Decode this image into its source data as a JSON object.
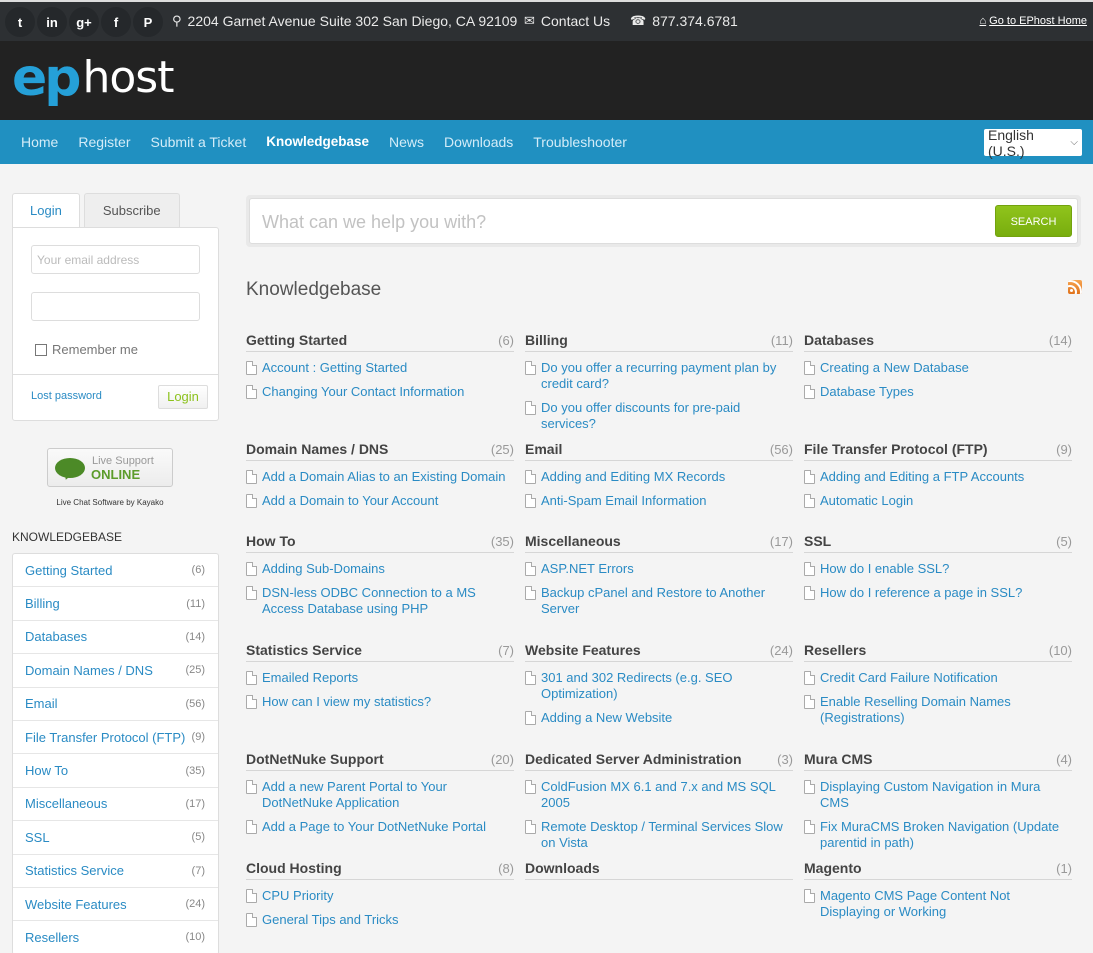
{
  "topbar": {
    "social": [
      {
        "name": "twitter-icon",
        "glyph": "t"
      },
      {
        "name": "linkedin-icon",
        "glyph": "in"
      },
      {
        "name": "google-plus-icon",
        "glyph": "g+"
      },
      {
        "name": "facebook-icon",
        "glyph": "f"
      },
      {
        "name": "pinterest-icon",
        "glyph": "P"
      }
    ],
    "address": "2204 Garnet Avenue Suite 302 San Diego, CA 92109",
    "contact": "Contact Us",
    "phone": "877.374.6781",
    "home_link": "Go to EPhost Home",
    "icons": {
      "pin": "⚲",
      "mail": "✉",
      "phone": "☎",
      "home": "⌂"
    }
  },
  "logo": {
    "ep": "ep",
    "host": "host"
  },
  "nav": {
    "items": [
      "Home",
      "Register",
      "Submit a Ticket",
      "Knowledgebase",
      "News",
      "Downloads",
      "Troubleshooter"
    ],
    "active": "Knowledgebase",
    "language": "English (U.S.)",
    "chevron": "⌵"
  },
  "login": {
    "tabs": [
      "Login",
      "Subscribe"
    ],
    "email_placeholder": "Your email address",
    "password_value": "",
    "remember": "Remember me",
    "lost_password": "Lost password",
    "login_button": "Login"
  },
  "live_support": {
    "line1": "Live Support",
    "line2": "ONLINE",
    "caption": "Live Chat Software by Kayako"
  },
  "sidebar": {
    "heading": "KNOWLEDGEBASE",
    "items": [
      {
        "label": "Getting Started",
        "count": "(6)"
      },
      {
        "label": "Billing",
        "count": "(11)"
      },
      {
        "label": "Databases",
        "count": "(14)"
      },
      {
        "label": "Domain Names / DNS",
        "count": "(25)"
      },
      {
        "label": "Email",
        "count": "(56)"
      },
      {
        "label": "File Transfer Protocol (FTP)",
        "count": "(9)"
      },
      {
        "label": "How To",
        "count": "(35)"
      },
      {
        "label": "Miscellaneous",
        "count": "(17)"
      },
      {
        "label": "SSL",
        "count": "(5)"
      },
      {
        "label": "Statistics Service",
        "count": "(7)"
      },
      {
        "label": "Website Features",
        "count": "(24)"
      },
      {
        "label": "Resellers",
        "count": "(10)"
      }
    ]
  },
  "search": {
    "placeholder": "What can we help you with?",
    "button": "SEARCH"
  },
  "main": {
    "title": "Knowledgebase",
    "categories": [
      {
        "name": "Getting Started",
        "count": "(6)",
        "articles": [
          "Account : Getting Started",
          "Changing Your Contact Information"
        ]
      },
      {
        "name": "Billing",
        "count": "(11)",
        "articles": [
          "Do you offer a recurring payment plan by credit card?",
          "Do you offer discounts for pre-paid services?"
        ]
      },
      {
        "name": "Databases",
        "count": "(14)",
        "articles": [
          "Creating a New Database",
          "Database Types"
        ]
      },
      {
        "name": "Domain Names / DNS",
        "count": "(25)",
        "articles": [
          "Add a Domain Alias to an Existing Domain",
          "Add a Domain to Your Account"
        ]
      },
      {
        "name": "Email",
        "count": "(56)",
        "articles": [
          "Adding and Editing MX Records",
          "Anti-Spam Email Information"
        ]
      },
      {
        "name": "File Transfer Protocol (FTP)",
        "count": "(9)",
        "articles": [
          "Adding and Editing a FTP Accounts",
          "Automatic Login"
        ]
      },
      {
        "name": "How To",
        "count": "(35)",
        "articles": [
          "Adding Sub-Domains",
          "DSN-less ODBC Connection to a MS Access Database using PHP"
        ]
      },
      {
        "name": "Miscellaneous",
        "count": "(17)",
        "articles": [
          "ASP.NET Errors",
          "Backup cPanel and Restore to Another Server"
        ]
      },
      {
        "name": "SSL",
        "count": "(5)",
        "articles": [
          "How do I enable SSL?",
          "How do I reference a page in SSL?"
        ]
      },
      {
        "name": "Statistics Service",
        "count": "(7)",
        "articles": [
          "Emailed Reports",
          "How can I view my statistics?"
        ]
      },
      {
        "name": "Website Features",
        "count": "(24)",
        "articles": [
          "301 and 302 Redirects (e.g. SEO Optimization)",
          "Adding a New Website"
        ]
      },
      {
        "name": "Resellers",
        "count": "(10)",
        "articles": [
          "Credit Card Failure Notification",
          "Enable Reselling Domain Names (Registrations)"
        ]
      },
      {
        "name": "DotNetNuke Support",
        "count": "(20)",
        "articles": [
          "Add a new Parent Portal to Your DotNetNuke Application",
          "Add a Page to Your DotNetNuke Portal"
        ]
      },
      {
        "name": "Dedicated Server Administration",
        "count": "(3)",
        "articles": [
          "ColdFusion MX 6.1 and 7.x and MS SQL 2005",
          "Remote Desktop / Terminal Services Slow on Vista"
        ]
      },
      {
        "name": "Mura CMS",
        "count": "(4)",
        "articles": [
          "Displaying Custom Navigation in Mura CMS",
          "Fix MuraCMS Broken Navigation (Update parentid in path)"
        ]
      },
      {
        "name": "Cloud Hosting",
        "count": "(8)",
        "articles": [
          "CPU Priority",
          "General Tips and Tricks"
        ]
      },
      {
        "name": "Downloads",
        "count": "",
        "articles": []
      },
      {
        "name": "Magento",
        "count": "(1)",
        "articles": [
          "Magento CMS Page Content Not Displaying or Working"
        ]
      }
    ]
  }
}
